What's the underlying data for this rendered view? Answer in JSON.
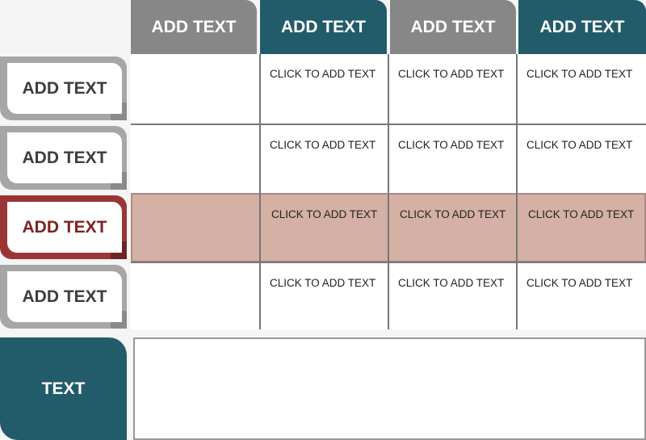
{
  "colors": {
    "gray": "#878787",
    "teal": "#225c6a",
    "red": "#9b3535",
    "highlight": "#d5b0a4"
  },
  "headers": [
    "ADD TEXT",
    "ADD TEXT",
    "ADD TEXT",
    "ADD TEXT"
  ],
  "rows": [
    {
      "label": "ADD TEXT",
      "cells": [
        "",
        "CLICK TO ADD TEXT",
        "CLICK TO ADD TEXT",
        "CLICK TO ADD TEXT"
      ]
    },
    {
      "label": "ADD TEXT",
      "cells": [
        "",
        "CLICK TO ADD TEXT",
        "CLICK TO ADD TEXT",
        "CLICK TO ADD TEXT"
      ]
    },
    {
      "label": "ADD TEXT",
      "cells": [
        "",
        "CLICK TO ADD TEXT",
        "CLICK TO ADD TEXT",
        "CLICK TO ADD TEXT"
      ],
      "highlighted": true
    },
    {
      "label": "ADD TEXT",
      "cells": [
        "",
        "CLICK TO ADD TEXT",
        "CLICK TO ADD TEXT",
        "CLICK TO ADD TEXT"
      ]
    }
  ],
  "footer": {
    "label": "TEXT",
    "content": ""
  }
}
